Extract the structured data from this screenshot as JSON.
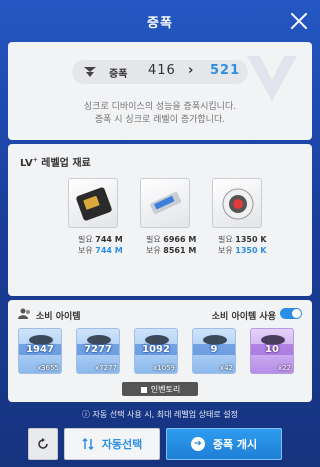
{
  "window": {
    "title": "증폭"
  },
  "enhance": {
    "label": "증폭",
    "from_level": "416",
    "arrow": "›",
    "to_level": "521",
    "desc_line1": "싱크로 디바이스의 성능을 증폭시킵니다.",
    "desc_line2": "증폭 시 싱크로 레벨이 증가합니다."
  },
  "materials": {
    "title": "LV",
    "title_sup": "+",
    "title_suffix": " 레벨업 재료",
    "items": [
      {
        "name": "chip-card",
        "req_label": "필요",
        "req_value": "744 M",
        "own_label": "보유",
        "own_value": "744 M"
      },
      {
        "name": "usb-drive",
        "req_label": "필요",
        "req_value": "6966 M",
        "own_label": "보유",
        "own_value": "8561 M"
      },
      {
        "name": "core-sphere",
        "req_label": "필요",
        "req_value": "1350 K",
        "own_label": "보유",
        "own_value": "1350 K"
      }
    ]
  },
  "consumables": {
    "title": "소비 아이템",
    "use_label": "소비 아이템 사용",
    "toggle_on": true,
    "cards": [
      {
        "value": "1947",
        "count": "x3655",
        "color": "blue"
      },
      {
        "value": "7277",
        "count": "x7277",
        "color": "blue"
      },
      {
        "value": "1092",
        "count": "x1059",
        "color": "blue"
      },
      {
        "value": "9",
        "count": "x42",
        "color": "blue"
      },
      {
        "value": "10",
        "count": "x22",
        "color": "purple"
      }
    ],
    "inventory_label": "인벤토리"
  },
  "footer": {
    "note": "ⓘ 자동 선택 사용 시, 최대 레벨업 상태로 설정",
    "auto_label": "자동선택",
    "start_label": "증폭 개시"
  },
  "colors": {
    "accent": "#2c8fe6",
    "backdrop": "#1f4fb4"
  }
}
